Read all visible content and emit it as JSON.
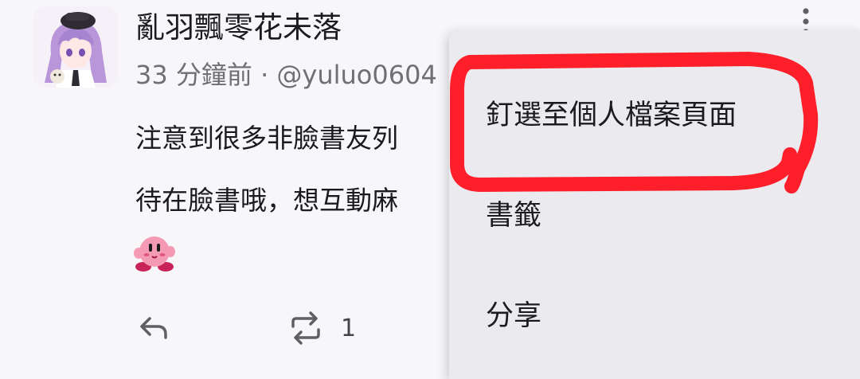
{
  "post": {
    "author_name": "亂羽飄零花未落",
    "meta": "33 分鐘前 · @yuluo0604",
    "body_lines": [
      "注意到很多非臉書友列",
      "待在臉書哦，想互動麻"
    ],
    "actions": {
      "repost_count": "1"
    }
  },
  "menu": {
    "items": [
      {
        "label": "釘選至個人檔案頁面"
      },
      {
        "label": "書籤"
      },
      {
        "label": "分享"
      }
    ]
  },
  "colors": {
    "highlight_stroke": "#ff1f2a",
    "menu_background": "#ebebef",
    "page_background": "#f7f7fa",
    "secondary_text": "#6f6f76"
  },
  "icons": {
    "avatar": "anime-girl-avatar",
    "emoji": "kirby-emoji",
    "reply": "reply-icon",
    "repost": "repost-icon",
    "favorite": "star-icon",
    "overflow": "more-vert-icon"
  }
}
